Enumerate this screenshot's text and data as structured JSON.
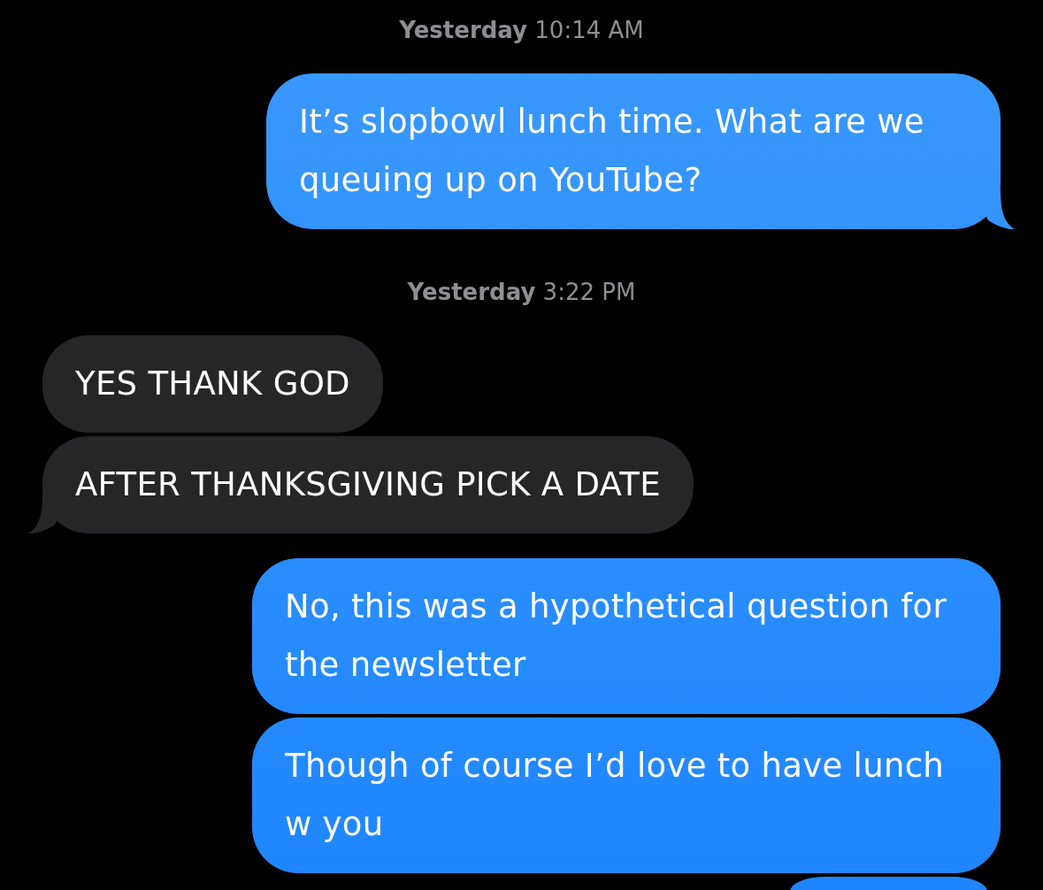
{
  "thread": [
    {
      "kind": "timestamp",
      "text": "**Yesterday** 10:14 AM"
    },
    {
      "kind": "sent",
      "text": "It’s slopbowl lunch time. What are we queuing up on YouTube?",
      "tail": true
    },
    {
      "kind": "timestamp",
      "text": "**Yesterday** 3:22 PM"
    },
    {
      "kind": "received",
      "text": "YES THANK GOD",
      "tail": false
    },
    {
      "kind": "received",
      "text": "AFTER THANKSGIVING PICK A DATE",
      "tail": true
    },
    {
      "kind": "sent",
      "text": "No, this was a hypothetical question for the newsletter",
      "tail": false
    },
    {
      "kind": "sent",
      "text": "Though of course I’d love to have lunch w you",
      "tail": false
    },
    {
      "kind": "sent",
      "tail": false
    }
  ]
}
